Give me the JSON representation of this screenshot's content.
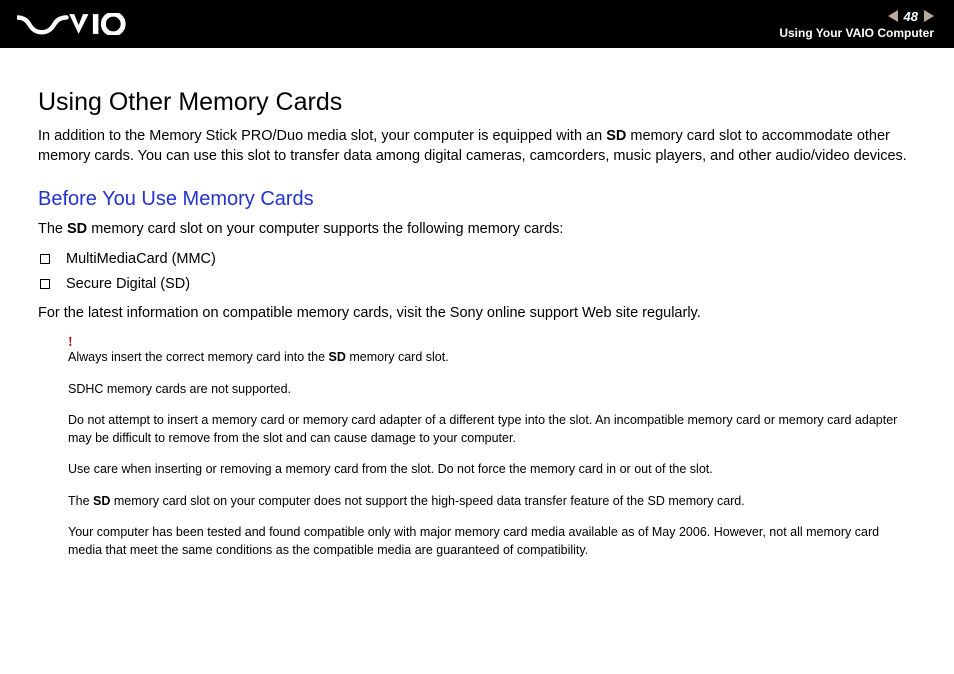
{
  "header": {
    "page_number": "48",
    "chapter": "Using Your VAIO Computer"
  },
  "content": {
    "main_heading": "Using Other Memory Cards",
    "intro_p1_a": "In addition to the Memory Stick PRO/Duo media slot, your computer is equipped with an ",
    "intro_p1_bold": "SD",
    "intro_p1_b": " memory card slot to accommodate other memory cards. You can use this slot to transfer data among digital cameras, camcorders, music players, and other audio/video devices.",
    "sub_heading": "Before You Use Memory Cards",
    "support_a": "The ",
    "support_bold": "SD",
    "support_b": " memory card slot on your computer supports the following memory cards:",
    "bullets": {
      "b1": "MultiMediaCard (MMC)",
      "b2": "Secure Digital (SD)"
    },
    "latest_info": "For the latest information on compatible memory cards, visit the Sony online support Web site regularly.",
    "warnings": {
      "w1_a": "Always insert the correct memory card into the ",
      "w1_bold": "SD",
      "w1_b": " memory card slot.",
      "w2": "SDHC memory cards are not supported.",
      "w3": "Do not attempt to insert a memory card or memory card adapter of a different type into the slot. An incompatible memory card or memory card adapter may be difficult to remove from the slot and can cause damage to your computer.",
      "w4": "Use care when inserting or removing a memory card from the slot. Do not force the memory card in or out of the slot.",
      "w5_a": "The ",
      "w5_bold": "SD",
      "w5_b": " memory card slot on your computer does not support the high-speed data transfer feature of the SD memory card.",
      "w6": "Your computer has been tested and found compatible only with major memory card media available as of May 2006. However, not all memory card media that meet the same conditions as the compatible media are guaranteed of compatibility."
    }
  }
}
